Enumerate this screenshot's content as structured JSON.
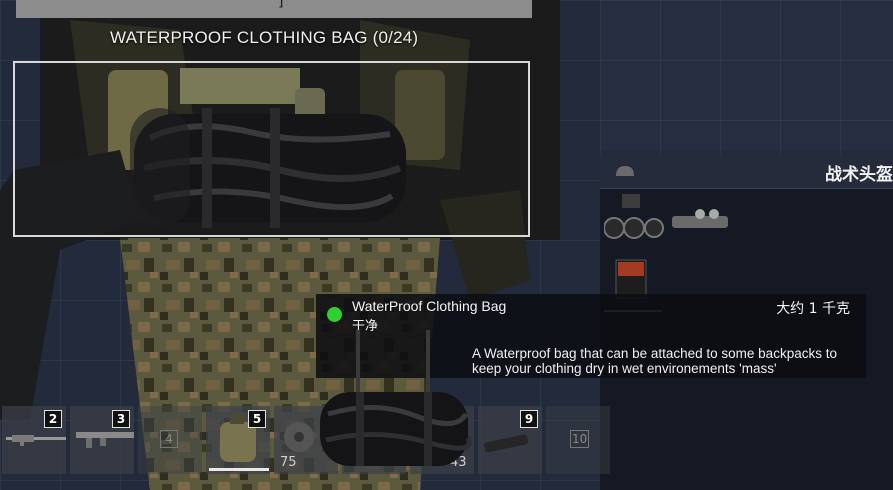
{
  "inventory": {
    "bag_title": "WATERPROOF CLOTHING BAG (0/24)"
  },
  "side_panel": {
    "title": "战术头盔"
  },
  "hotbar": {
    "slots": [
      {
        "number": "2",
        "item": "rifle-icon",
        "count": ""
      },
      {
        "number": "3",
        "item": "smg-icon",
        "count": ""
      },
      {
        "number": "4",
        "item": "",
        "count": ""
      },
      {
        "number": "5",
        "item": "canteen-pouch-icon",
        "count": ""
      },
      {
        "number": "",
        "item": "drum-magazine-icon",
        "count": "75"
      },
      {
        "number": "",
        "item": "",
        "count": ""
      },
      {
        "number": "",
        "item": "",
        "count": "43"
      },
      {
        "number": "9",
        "item": "flashlight-icon",
        "count": ""
      },
      {
        "number": "10",
        "item": "",
        "count": ""
      }
    ],
    "active_slot": 3
  },
  "tooltip": {
    "name": "WaterProof Clothing Bag",
    "condition": "干净",
    "weight": "大约 1 千克",
    "description": "A Waterproof bag that can be attached to some backpacks to keep your clothing dry in wet environements 'mass'",
    "condition_color": "#2fd12f"
  }
}
